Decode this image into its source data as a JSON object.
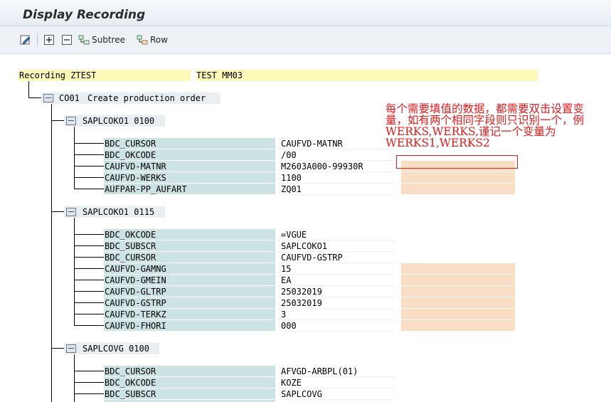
{
  "window": {
    "title": "Display Recording"
  },
  "toolbar": {
    "subtree_label": "Subtree",
    "row_label": "Row"
  },
  "recording": {
    "label": "Recording ZTEST",
    "description": "TEST MM03"
  },
  "tcode": {
    "code": "CO01",
    "text": "Create production order"
  },
  "screens": [
    {
      "program": "SAPLCOKO1 0100",
      "fields": [
        {
          "name": "BDC_CURSOR",
          "value": "CAUFVD-MATNR"
        },
        {
          "name": "BDC_OKCODE",
          "value": "/00"
        },
        {
          "name": "CAUFVD-MATNR",
          "value": "M2603A000-99930R"
        },
        {
          "name": "CAUFVD-WERKS",
          "value": "1100"
        },
        {
          "name": "AUFPAR-PP_AUFART",
          "value": "ZQ01"
        }
      ]
    },
    {
      "program": "SAPLCOKO1 0115",
      "fields": [
        {
          "name": "BDC_OKCODE",
          "value": "=VGUE"
        },
        {
          "name": "BDC_SUBSCR",
          "value": "SAPLCOKO1"
        },
        {
          "name": "BDC_CURSOR",
          "value": "CAUFVD-GSTRP"
        },
        {
          "name": "CAUFVD-GAMNG",
          "value": "15"
        },
        {
          "name": "CAUFVD-GMEIN",
          "value": "EA"
        },
        {
          "name": "CAUFVD-GLTRP",
          "value": "25032019"
        },
        {
          "name": "CAUFVD-GSTRP",
          "value": "25032019"
        },
        {
          "name": "CAUFVD-TERKZ",
          "value": "3"
        },
        {
          "name": "CAUFVD-FHORI",
          "value": "000"
        }
      ]
    },
    {
      "program": "SAPLCOVG 0100",
      "fields": [
        {
          "name": "BDC_CURSOR",
          "value": "AFVGD-ARBPL(01)"
        },
        {
          "name": "BDC_OKCODE",
          "value": "KOZE"
        },
        {
          "name": "BDC_SUBSCR",
          "value": "SAPLCOVG"
        }
      ]
    }
  ],
  "annotation": {
    "text": "每个需要填值的数据，都需要双击设置变量，如有两个相同字段则只识别一个，例WERKS,WERKS,谨记一个变量为WERKS1,WERKS2",
    "color": "#e01b1b"
  },
  "colors": {
    "field_bg": "#cde2e2",
    "extra_bg": "#f9dec5",
    "recording_bg": "#fdf9b9"
  }
}
